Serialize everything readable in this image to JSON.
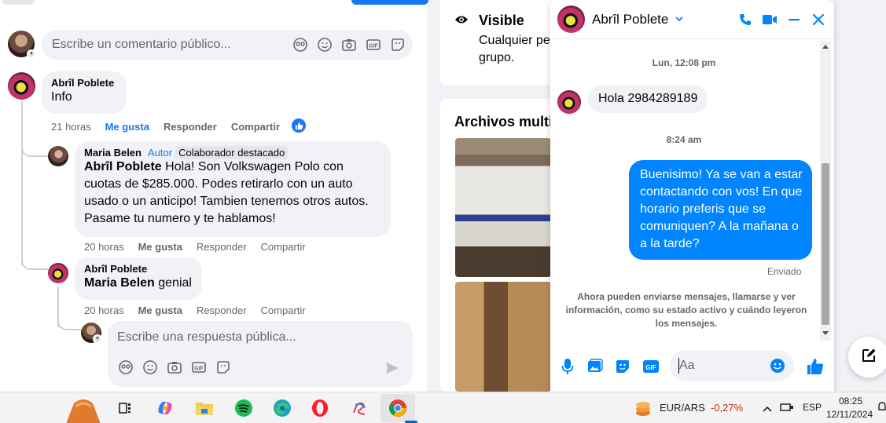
{
  "feed": {
    "comment_placeholder": "Escribe un comentario público...",
    "comments": [
      {
        "author": "Abrîl Poblete",
        "text": "Info",
        "time": "21 horas",
        "like_label": "Me gusta",
        "reply_label": "Responder",
        "share_label": "Compartir"
      },
      {
        "author": "Maria Belen",
        "author_tag": "Autor",
        "collab_tag": "Colaborador destacado",
        "mention": "Abrîl Poblete",
        "text": " Hola! Son Volkswagen Polo con cuotas de $285.000. Podes retirarlo con un auto usado o un anticipo! Tambien tenemos otros autos. Pasame tu numero y te hablamos!",
        "time": "20 horas",
        "like_label": "Me gusta",
        "reply_label": "Responder",
        "share_label": "Compartir"
      },
      {
        "author": "Abrîl Poblete",
        "mention": "Maria Belen",
        "text": " genial",
        "time": "20 horas",
        "like_label": "Me gusta",
        "reply_label": "Responder",
        "share_label": "Compartir"
      }
    ],
    "reply_placeholder": "Escribe una respuesta pública..."
  },
  "group_info": {
    "visibility_title": "Visible",
    "visibility_desc": "Cualquier pe grupo.",
    "media_title": "Archivos multi"
  },
  "chat": {
    "contact_name": "Abrîl Poblete",
    "timestamp_1": "Lun, 12:08 pm",
    "incoming_message": "Hola 2984289189",
    "timestamp_2": "8:24 am",
    "outgoing_message": "Buenisimo! Ya se van a estar contactando con vos! En que horario preferis que se comuniquen? A la mañana o a la tarde?",
    "status": "Enviado",
    "info_note": "Ahora pueden enviarse mensajes, llamarse y ver información, como su estado activo y cuándo leyeron los mensajes.",
    "input_placeholder": "Aa",
    "accent_color": "#0084ff"
  },
  "taskbar": {
    "currency_pair": "EUR/ARS",
    "currency_change": "-0,27%",
    "currency_change_color": "#c42b1c",
    "language": "ESP",
    "time": "08:25",
    "date": "12/11/2024",
    "apps": [
      "task-view-icon",
      "copilot-icon",
      "file-explorer-icon",
      "spotify-icon",
      "edge-icon",
      "opera-icon",
      "app-icon",
      "chrome-icon"
    ]
  }
}
